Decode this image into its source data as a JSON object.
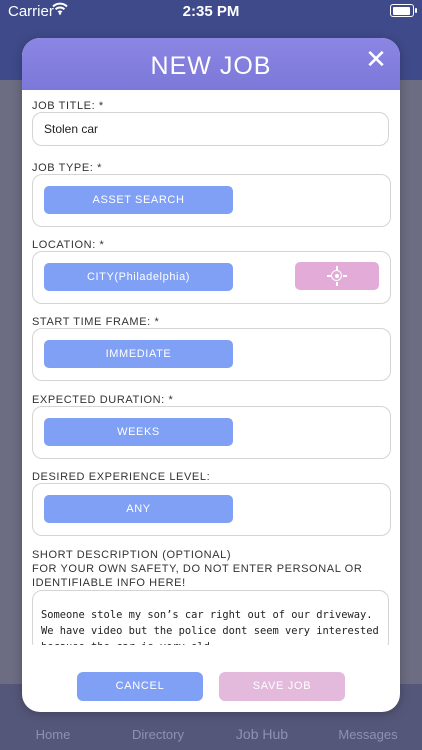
{
  "status_bar": {
    "carrier": "Carrier",
    "time": "2:35 PM"
  },
  "background_tabs": [
    {
      "label": "Home"
    },
    {
      "label": "Directory"
    },
    {
      "label": "Job Hub"
    },
    {
      "label": "Messages"
    }
  ],
  "modal": {
    "title": "NEW JOB",
    "fields": {
      "job_title": {
        "label": "JOB TITLE: *",
        "value": "Stolen car"
      },
      "job_type": {
        "label": "JOB TYPE: *",
        "value": "ASSET SEARCH"
      },
      "location": {
        "label": "LOCATION: *",
        "value": "CITY(Philadelphia)"
      },
      "start_time": {
        "label": "START TIME FRAME: *",
        "value": "IMMEDIATE"
      },
      "duration": {
        "label": "EXPECTED DURATION: *",
        "value": "WEEKS"
      },
      "experience": {
        "label": "DESIRED EXPERIENCE LEVEL:",
        "value": "ANY"
      },
      "description": {
        "label": "SHORT DESCRIPTION (OPTIONAL)",
        "warning_line1": "FOR YOUR OWN SAFETY, DO NOT ENTER PERSONAL OR",
        "warning_line2": "IDENTIFIABLE INFO HERE!",
        "value": "Someone stole my son’s car right out of our driveway.  We have video but the police dont seem very interested because the car is very old."
      }
    },
    "cancel_label": "CANCEL",
    "save_label": "SAVE JOB"
  },
  "colors": {
    "header": "#7c78d9",
    "primary_button": "#7fa0f5",
    "accent_button": "#e3abd7"
  }
}
